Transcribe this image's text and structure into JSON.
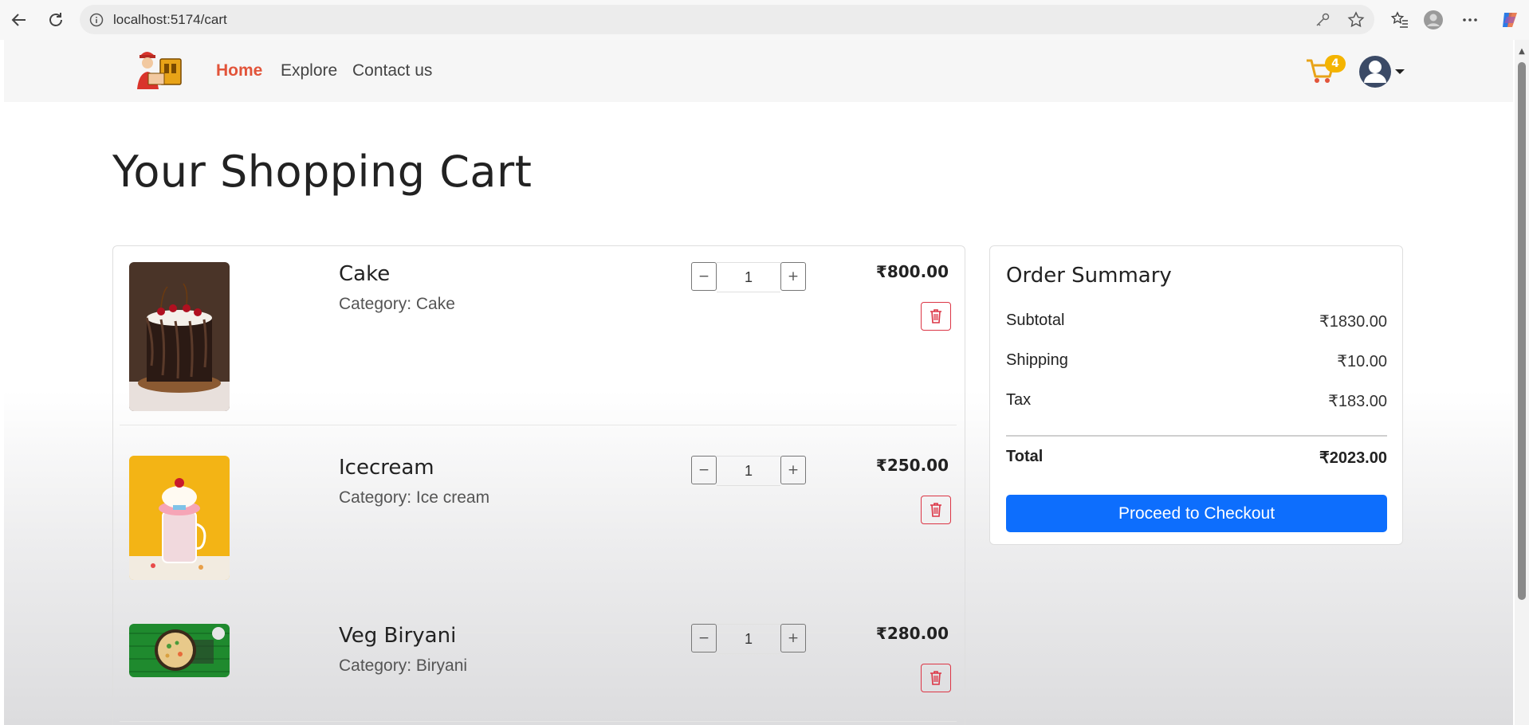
{
  "browser": {
    "url": "localhost:5174/cart"
  },
  "navbar": {
    "links": [
      {
        "label": "Home",
        "active": true
      },
      {
        "label": "Explore",
        "active": false
      },
      {
        "label": "Contact us",
        "active": false
      }
    ],
    "cart_count": "4"
  },
  "page": {
    "title": "Your Shopping Cart"
  },
  "cart": {
    "items": [
      {
        "name": "Cake",
        "category": "Category: Cake",
        "quantity": "1",
        "price": "₹800.00",
        "image": "cake"
      },
      {
        "name": "Icecream",
        "category": "Category: Ice cream",
        "quantity": "1",
        "price": "₹250.00",
        "image": "icecream"
      },
      {
        "name": "Veg Biryani",
        "category": "Category: Biryani",
        "quantity": "1",
        "price": "₹280.00",
        "image": "biryani"
      }
    ],
    "minus_label": "−",
    "plus_label": "+"
  },
  "summary": {
    "title": "Order Summary",
    "subtotal_label": "Subtotal",
    "subtotal_value": "₹1830.00",
    "shipping_label": "Shipping",
    "shipping_value": "₹10.00",
    "tax_label": "Tax",
    "tax_value": "₹183.00",
    "total_label": "Total",
    "total_value": "₹2023.00",
    "checkout_label": "Proceed to Checkout"
  },
  "colors": {
    "accent": "#e2543a",
    "primary": "#0d6efd",
    "danger": "#dc3545",
    "badge": "#f4b400"
  }
}
